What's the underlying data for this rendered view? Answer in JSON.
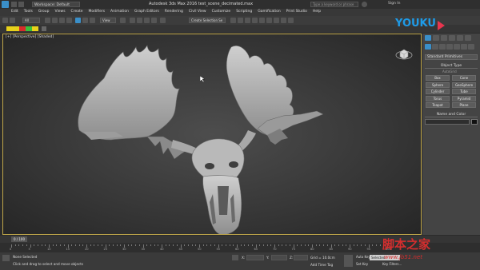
{
  "app": {
    "title": "Autodesk 3ds Max 2016     test_scene_decimated.max",
    "workspace": "Workspace: Default",
    "search_placeholder": "Type a keyword or phrase",
    "sign_in": "Sign In"
  },
  "menu": [
    "Edit",
    "Tools",
    "Group",
    "Views",
    "Create",
    "Modifiers",
    "Animation",
    "Graph Editors",
    "Rendering",
    "Civil View",
    "Customize",
    "Scripting",
    "Gamification",
    "Print Studio",
    "Help"
  ],
  "toolbar": {
    "selection_filter": "All",
    "view_dropdown": "View",
    "selection_set": "Create Selection Se"
  },
  "viewport": {
    "label": "[+] [Perspective] [Shaded]"
  },
  "command_panel": {
    "category": "Standard Primitives",
    "object_type_header": "Object Type",
    "autogrid": "AutoGrid",
    "buttons": [
      "Box",
      "Cone",
      "Sphere",
      "GeoSphere",
      "Cylinder",
      "Tube",
      "Torus",
      "Pyramid",
      "Teapot",
      "Plane"
    ],
    "name_color_header": "Name and Color"
  },
  "timeline": {
    "frame": "0 / 100",
    "ticks": [
      "0",
      "5",
      "10",
      "15",
      "20",
      "25",
      "30",
      "35",
      "40",
      "45",
      "50",
      "55",
      "60",
      "65",
      "70",
      "75",
      "80",
      "85",
      "90",
      "95",
      "100"
    ]
  },
  "status": {
    "selection": "None Selected",
    "prompt": "Click and drag to select and move objects",
    "x_label": "X:",
    "y_label": "Y:",
    "z_label": "Z:",
    "grid": "Grid = 10.0cm",
    "add_time_tag": "Add Time Tag",
    "auto_key": "Auto Key",
    "selected": "Selected",
    "set_key": "Set Key",
    "key_filters": "Key Filters..."
  },
  "overlays": {
    "youku": "YOUKU",
    "watermark": "脚本之家",
    "watermark_url": "www.jb51.net"
  },
  "colors": {
    "accent": "#3a8fc9",
    "viewport_border": "#bfa64a",
    "youku_blue": "#1e9be8",
    "youku_red": "#e8354e",
    "watermark_red": "#d52e2e"
  }
}
